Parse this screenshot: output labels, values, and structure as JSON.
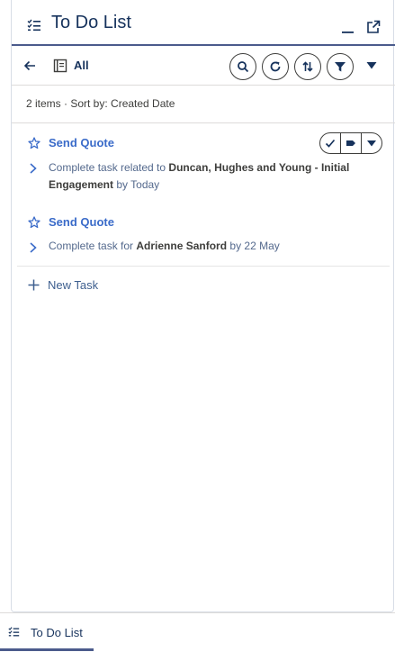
{
  "panel": {
    "title": "To Do List",
    "title_icon": "task-list-icon",
    "minimize_icon": "minimize-icon",
    "popout_icon": "popout-icon"
  },
  "toolbar": {
    "back_icon": "back-arrow-icon",
    "view_icon": "list-view-icon",
    "view_label": "All",
    "buttons": [
      "search-icon",
      "refresh-icon",
      "sort-icon",
      "filter-icon"
    ],
    "menu_icon": "chevron-down-icon"
  },
  "summary": "2 items · Sort by: Created Date",
  "tasks": [
    {
      "title": "Send Quote",
      "desc_prefix": "Complete task related to ",
      "desc_subject": "Duncan, Hughes and Young - Initial Engagement",
      "desc_suffix": " by Today"
    },
    {
      "title": "Send Quote",
      "desc_prefix": "Complete task for ",
      "desc_subject": "Adrienne Sanford",
      "desc_suffix": " by 22 May"
    }
  ],
  "task_actions": [
    "check-icon",
    "tag-icon",
    "chevron-down-icon"
  ],
  "new_task_label": "New Task",
  "utility_bar": {
    "item_label": "To Do List",
    "item_icon": "task-list-icon"
  },
  "colors": {
    "accent": "#4b5b8c",
    "link": "#3a6bc9",
    "title": "#16325c"
  }
}
